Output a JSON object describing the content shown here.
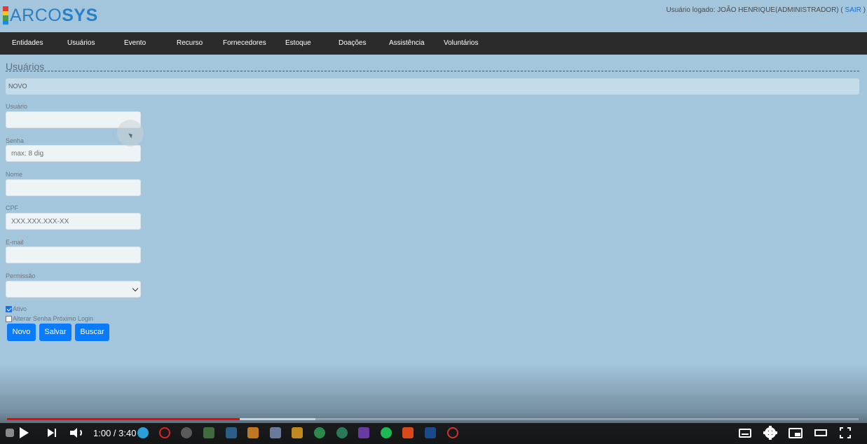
{
  "header": {
    "logo_prefix": "ARCO",
    "logo_suffix": "SYS",
    "user_label": "Usuário logado: JOÃO HENRIQUE(ADMINISTRADOR) (",
    "logout": "SAIR",
    "user_close": ")"
  },
  "nav": {
    "items": [
      "Entidades",
      "Usuários",
      "Evento",
      "Recurso",
      "Fornecedores",
      "Estoque",
      "Doações",
      "Assistência",
      "Voluntários"
    ]
  },
  "page": {
    "title": "Usuários",
    "mode": "NOVO"
  },
  "form": {
    "usuario": {
      "label": "Usuário",
      "value": "",
      "placeholder": ""
    },
    "senha": {
      "label": "Senha",
      "value": "",
      "placeholder": "max: 8 dig"
    },
    "nome": {
      "label": "Nome",
      "value": "",
      "placeholder": ""
    },
    "cpf": {
      "label": "CPF",
      "value": "",
      "placeholder": "XXX.XXX.XXX-XX"
    },
    "email": {
      "label": "E-mail",
      "value": "",
      "placeholder": ""
    },
    "permissao": {
      "label": "Permissão",
      "selected": ""
    },
    "ativo": {
      "label": "Ativo",
      "checked": true
    },
    "alterar_senha": {
      "label": "Alterar Senha Próximo Login",
      "checked": false
    },
    "buttons": {
      "novo": "Novo",
      "salvar": "Salvar",
      "buscar": "Buscar"
    }
  },
  "player": {
    "current_time": "1:00",
    "duration": "3:40",
    "time_display": "1:00 / 3:40",
    "progress_fraction": 0.273
  },
  "colors": {
    "page_bg": "#a3c6dc",
    "navbar_bg": "#2b2b2b",
    "button_bg": "#0a7bff",
    "progress_played": "#ff0000"
  }
}
